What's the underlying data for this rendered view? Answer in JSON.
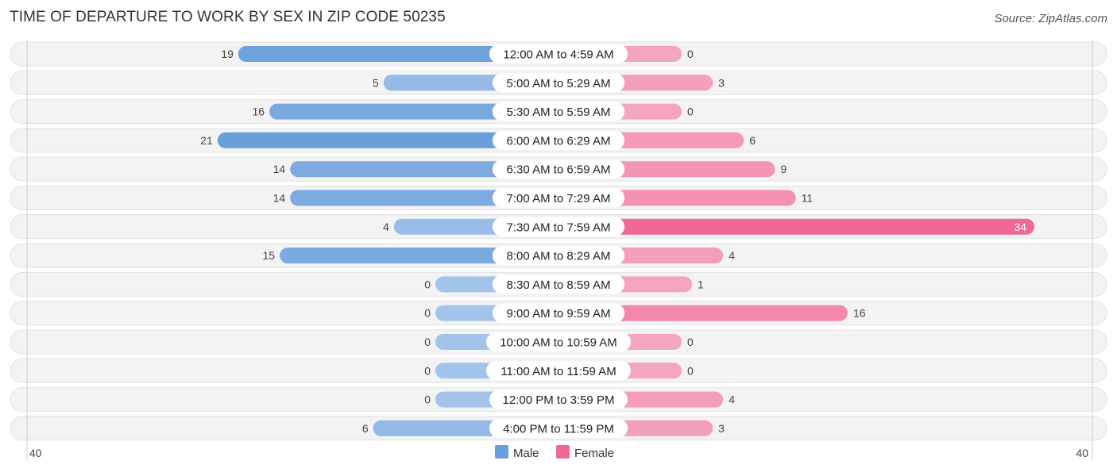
{
  "header": {
    "title": "TIME OF DEPARTURE TO WORK BY SEX IN ZIP CODE 50235",
    "source": "Source: ZipAtlas.com"
  },
  "colors": {
    "male": "#6a9fdb",
    "male_light": "#a3c4ea",
    "female": "#f06893",
    "female_light": "#f6a5be",
    "row_bg": "#f3f3f3"
  },
  "chart_data": {
    "type": "bar",
    "orientation": "horizontal-diverging",
    "title": "TIME OF DEPARTURE TO WORK BY SEX IN ZIP CODE 50235",
    "categories": [
      "12:00 AM to 4:59 AM",
      "5:00 AM to 5:29 AM",
      "5:30 AM to 5:59 AM",
      "6:00 AM to 6:29 AM",
      "6:30 AM to 6:59 AM",
      "7:00 AM to 7:29 AM",
      "7:30 AM to 7:59 AM",
      "8:00 AM to 8:29 AM",
      "8:30 AM to 8:59 AM",
      "9:00 AM to 9:59 AM",
      "10:00 AM to 10:59 AM",
      "11:00 AM to 11:59 AM",
      "12:00 PM to 3:59 PM",
      "4:00 PM to 11:59 PM"
    ],
    "series": [
      {
        "name": "Male",
        "values": [
          19,
          5,
          16,
          21,
          14,
          14,
          4,
          15,
          0,
          0,
          0,
          0,
          0,
          6
        ]
      },
      {
        "name": "Female",
        "values": [
          0,
          3,
          0,
          6,
          9,
          11,
          34,
          4,
          1,
          16,
          0,
          0,
          4,
          3
        ]
      }
    ],
    "axis": {
      "left_label": "40",
      "right_label": "40",
      "max": 40
    },
    "legend": {
      "items": [
        "Male",
        "Female"
      ],
      "position": "bottom-center"
    },
    "grid": false
  }
}
